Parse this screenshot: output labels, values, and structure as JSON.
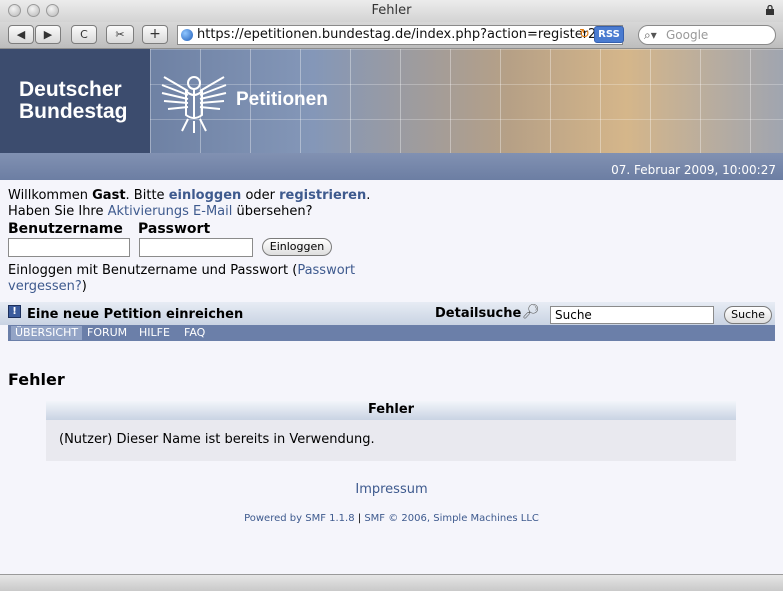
{
  "browser": {
    "window_title": "Fehler",
    "url": "https://epetitionen.bundestag.de/index.php?action=register2",
    "rss_label": "RSS",
    "search_placeholder": "Google",
    "buttons": {
      "back": "◀",
      "forward": "▶",
      "reload": "C",
      "bookmark": "✂",
      "add": "+"
    }
  },
  "banner": {
    "brand_line1": "Deutscher",
    "brand_line2": "Bundestag",
    "section": "Petitionen",
    "datetime": "07. Februar 2009, 10:00:27"
  },
  "welcome": {
    "prefix": "Willkommen",
    "guest": "Gast",
    "mid": ". Bitte",
    "login_link": "einloggen",
    "or": "oder",
    "register_link": "registrieren",
    "end": ".",
    "line2_prefix": "Haben Sie Ihre",
    "activation_link": "Aktivierungs E-Mail",
    "line2_suffix": "übersehen?"
  },
  "login": {
    "username_label": "Benutzername",
    "password_label": "Passwort",
    "submit": "Einloggen",
    "hint_prefix": "Einloggen mit Benutzername und Passwort (",
    "forgot_link": "Passwort vergessen?",
    "hint_suffix": ")"
  },
  "actions": {
    "new_petition": "Eine neue Petition einreichen",
    "detail_search": "Detailsuche",
    "search_value": "Suche",
    "search_button": "Suche"
  },
  "menu": {
    "items": [
      {
        "label": "ÜBERSICHT",
        "active": true
      },
      {
        "label": "FORUM",
        "active": false
      },
      {
        "label": "HILFE",
        "active": false
      },
      {
        "label": "FAQ",
        "active": false
      }
    ]
  },
  "main": {
    "title": "Fehler",
    "box_title": "Fehler",
    "message": "(Nutzer) Dieser Name ist bereits in Verwendung."
  },
  "footer": {
    "impressum": "Impressum",
    "powered_by": "Powered by SMF 1.1.8",
    "separator": "|",
    "copyright": "SMF © 2006, Simple Machines LLC"
  },
  "colors": {
    "link": "#3e5a8e",
    "menubar": "#6b7fa9",
    "page_bg": "#f5f5fb"
  }
}
